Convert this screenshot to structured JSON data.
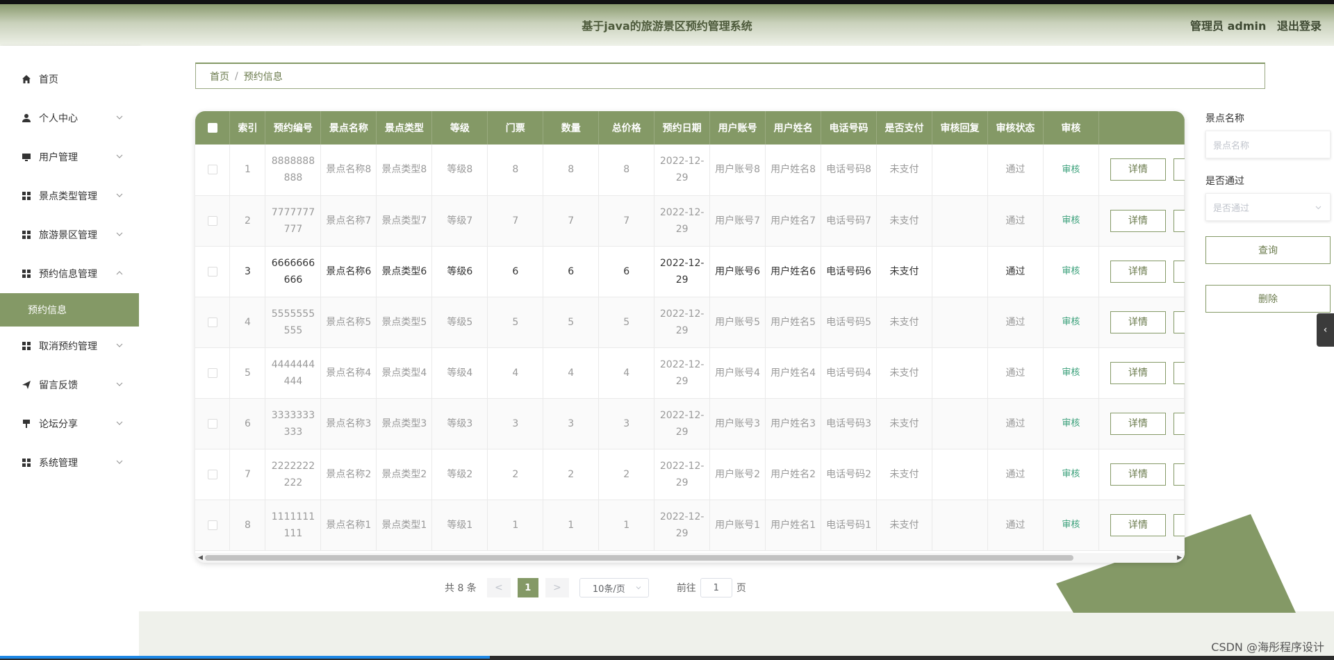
{
  "header": {
    "title": "基于java的旅游景区预约管理系统",
    "user_role": "管理员 admin",
    "logout": "退出登录"
  },
  "sidebar": {
    "items": [
      {
        "label": "首页",
        "icon": "home-icon"
      },
      {
        "label": "个人中心",
        "icon": "user-icon"
      },
      {
        "label": "用户管理",
        "icon": "monitor-icon"
      },
      {
        "label": "景点类型管理",
        "icon": "grid-icon"
      },
      {
        "label": "旅游景区管理",
        "icon": "grid-icon"
      },
      {
        "label": "预约信息管理",
        "icon": "grid-icon"
      },
      {
        "label": "预约信息",
        "icon": ""
      },
      {
        "label": "取消预约管理",
        "icon": "grid-icon"
      },
      {
        "label": "留言反馈",
        "icon": "send-icon"
      },
      {
        "label": "论坛分享",
        "icon": "brush-icon"
      },
      {
        "label": "系统管理",
        "icon": "grid-icon"
      }
    ]
  },
  "breadcrumb": {
    "home": "首页",
    "sep": "/",
    "current": "预约信息"
  },
  "table": {
    "headers": [
      "索引",
      "预约编号",
      "景点名称",
      "景点类型",
      "等级",
      "门票",
      "数量",
      "总价格",
      "预约日期",
      "用户账号",
      "用户姓名",
      "电话号码",
      "是否支付",
      "审核回复",
      "审核状态",
      "审核"
    ],
    "rows": [
      {
        "idx": "1",
        "no": "8888888888",
        "name": "景点名称8",
        "type": "景点类型8",
        "level": "等级8",
        "ticket": "8",
        "qty": "8",
        "total": "8",
        "date": "2022-12-29",
        "account": "用户账号8",
        "uname": "用户姓名8",
        "phone": "电话号码8",
        "paid": "未支付",
        "reply": "",
        "status": "通过",
        "audit": "审核",
        "detail": "详情"
      },
      {
        "idx": "2",
        "no": "7777777777",
        "name": "景点名称7",
        "type": "景点类型7",
        "level": "等级7",
        "ticket": "7",
        "qty": "7",
        "total": "7",
        "date": "2022-12-29",
        "account": "用户账号7",
        "uname": "用户姓名7",
        "phone": "电话号码7",
        "paid": "未支付",
        "reply": "",
        "status": "通过",
        "audit": "审核",
        "detail": "详情"
      },
      {
        "idx": "3",
        "no": "6666666666",
        "name": "景点名称6",
        "type": "景点类型6",
        "level": "等级6",
        "ticket": "6",
        "qty": "6",
        "total": "6",
        "date": "2022-12-29",
        "account": "用户账号6",
        "uname": "用户姓名6",
        "phone": "电话号码6",
        "paid": "未支付",
        "reply": "",
        "status": "通过",
        "audit": "审核",
        "detail": "详情"
      },
      {
        "idx": "4",
        "no": "5555555555",
        "name": "景点名称5",
        "type": "景点类型5",
        "level": "等级5",
        "ticket": "5",
        "qty": "5",
        "total": "5",
        "date": "2022-12-29",
        "account": "用户账号5",
        "uname": "用户姓名5",
        "phone": "电话号码5",
        "paid": "未支付",
        "reply": "",
        "status": "通过",
        "audit": "审核",
        "detail": "详情"
      },
      {
        "idx": "5",
        "no": "4444444444",
        "name": "景点名称4",
        "type": "景点类型4",
        "level": "等级4",
        "ticket": "4",
        "qty": "4",
        "total": "4",
        "date": "2022-12-29",
        "account": "用户账号4",
        "uname": "用户姓名4",
        "phone": "电话号码4",
        "paid": "未支付",
        "reply": "",
        "status": "通过",
        "audit": "审核",
        "detail": "详情"
      },
      {
        "idx": "6",
        "no": "3333333333",
        "name": "景点名称3",
        "type": "景点类型3",
        "level": "等级3",
        "ticket": "3",
        "qty": "3",
        "total": "3",
        "date": "2022-12-29",
        "account": "用户账号3",
        "uname": "用户姓名3",
        "phone": "电话号码3",
        "paid": "未支付",
        "reply": "",
        "status": "通过",
        "audit": "审核",
        "detail": "详情"
      },
      {
        "idx": "7",
        "no": "2222222222",
        "name": "景点名称2",
        "type": "景点类型2",
        "level": "等级2",
        "ticket": "2",
        "qty": "2",
        "total": "2",
        "date": "2022-12-29",
        "account": "用户账号2",
        "uname": "用户姓名2",
        "phone": "电话号码2",
        "paid": "未支付",
        "reply": "",
        "status": "通过",
        "audit": "审核",
        "detail": "详情"
      },
      {
        "idx": "8",
        "no": "1111111111",
        "name": "景点名称1",
        "type": "景点类型1",
        "level": "等级1",
        "ticket": "1",
        "qty": "1",
        "total": "1",
        "date": "2022-12-29",
        "account": "用户账号1",
        "uname": "用户姓名1",
        "phone": "电话号码1",
        "paid": "未支付",
        "reply": "",
        "status": "通过",
        "audit": "审核",
        "detail": "详情"
      }
    ]
  },
  "pagination": {
    "total": "共 8 条",
    "prev": "<",
    "page": "1",
    "next": ">",
    "page_size": "10条/页",
    "goto_label": "前往",
    "goto_value": "1",
    "page_unit": "页"
  },
  "search": {
    "name_label": "景点名称",
    "name_placeholder": "景点名称",
    "pass_label": "是否通过",
    "pass_placeholder": "是否通过",
    "query_button": "查询",
    "delete_button": "删除"
  },
  "watermark": "CSDN @海彤程序设计",
  "colors": {
    "accent": "#849966",
    "audit_link": "#3aa07a"
  }
}
